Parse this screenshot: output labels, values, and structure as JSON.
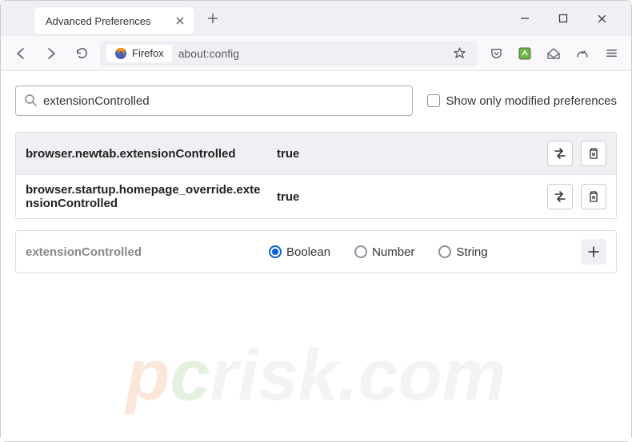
{
  "window": {
    "tab_title": "Advanced Preferences"
  },
  "toolbar": {
    "firefox_label": "Firefox",
    "address": "about:config"
  },
  "search": {
    "value": "extensionControlled",
    "checkbox_label": "Show only modified preferences"
  },
  "prefs": [
    {
      "name": "browser.newtab.extensionControlled",
      "value": "true"
    },
    {
      "name": "browser.startup.homepage_override.extensionControlled",
      "value": "true"
    }
  ],
  "add": {
    "name": "extensionControlled",
    "types": {
      "boolean": "Boolean",
      "number": "Number",
      "string": "String"
    },
    "selected": "boolean"
  },
  "watermark": {
    "text_prefix": "p",
    "text_mid": "c",
    "text_suffix": "risk.com"
  }
}
